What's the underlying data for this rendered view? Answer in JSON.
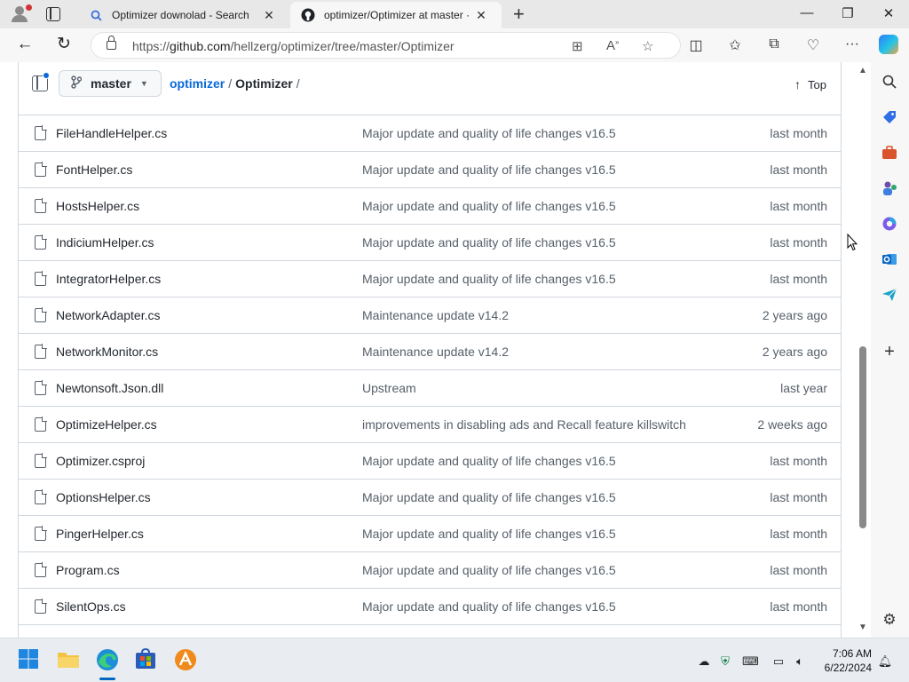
{
  "browser": {
    "tabs": [
      {
        "title": "Optimizer downolad - Search",
        "icon": "search-icon",
        "active": false
      },
      {
        "title": "optimizer/Optimizer at master · hellzerg/Optimizer",
        "icon": "github-icon",
        "active": true
      }
    ],
    "new_tab": "+",
    "address": {
      "prefix": "https://",
      "domain": "github.com",
      "path": "/hellzerg/optimizer/tree/master/Optimizer"
    }
  },
  "repo_header": {
    "branch": "master",
    "breadcrumb_repo": "optimizer",
    "breadcrumb_separator": "/",
    "breadcrumb_folder": "Optimizer",
    "breadcrumb_trailing": "/",
    "top_link": "Top"
  },
  "files": [
    {
      "name": "FileHandleHelper.cs",
      "message": "Major update and quality of life changes v16.5",
      "date": "last month"
    },
    {
      "name": "FontHelper.cs",
      "message": "Major update and quality of life changes v16.5",
      "date": "last month"
    },
    {
      "name": "HostsHelper.cs",
      "message": "Major update and quality of life changes v16.5",
      "date": "last month"
    },
    {
      "name": "IndiciumHelper.cs",
      "message": "Major update and quality of life changes v16.5",
      "date": "last month"
    },
    {
      "name": "IntegratorHelper.cs",
      "message": "Major update and quality of life changes v16.5",
      "date": "last month"
    },
    {
      "name": "NetworkAdapter.cs",
      "message": "Maintenance update v14.2",
      "date": "2 years ago"
    },
    {
      "name": "NetworkMonitor.cs",
      "message": "Maintenance update v14.2",
      "date": "2 years ago"
    },
    {
      "name": "Newtonsoft.Json.dll",
      "message": "Upstream",
      "date": "last year"
    },
    {
      "name": "OptimizeHelper.cs",
      "message": "improvements in disabling ads and Recall feature killswitch",
      "date": "2 weeks ago"
    },
    {
      "name": "Optimizer.csproj",
      "message": "Major update and quality of life changes v16.5",
      "date": "last month"
    },
    {
      "name": "OptionsHelper.cs",
      "message": "Major update and quality of life changes v16.5",
      "date": "last month"
    },
    {
      "name": "PingerHelper.cs",
      "message": "Major update and quality of life changes v16.5",
      "date": "last month"
    },
    {
      "name": "Program.cs",
      "message": "Major update and quality of life changes v16.5",
      "date": "last month"
    },
    {
      "name": "SilentOps.cs",
      "message": "Major update and quality of life changes v16.5",
      "date": "last month"
    }
  ],
  "taskbar": {
    "apps": [
      "start-icon",
      "file-explorer-icon",
      "edge-icon",
      "store-icon",
      "app-icon"
    ],
    "time": "7:06 AM",
    "date": "6/22/2024"
  },
  "colors": {
    "link": "#0969da",
    "muted": "#57606a",
    "border": "#d0d7de"
  }
}
